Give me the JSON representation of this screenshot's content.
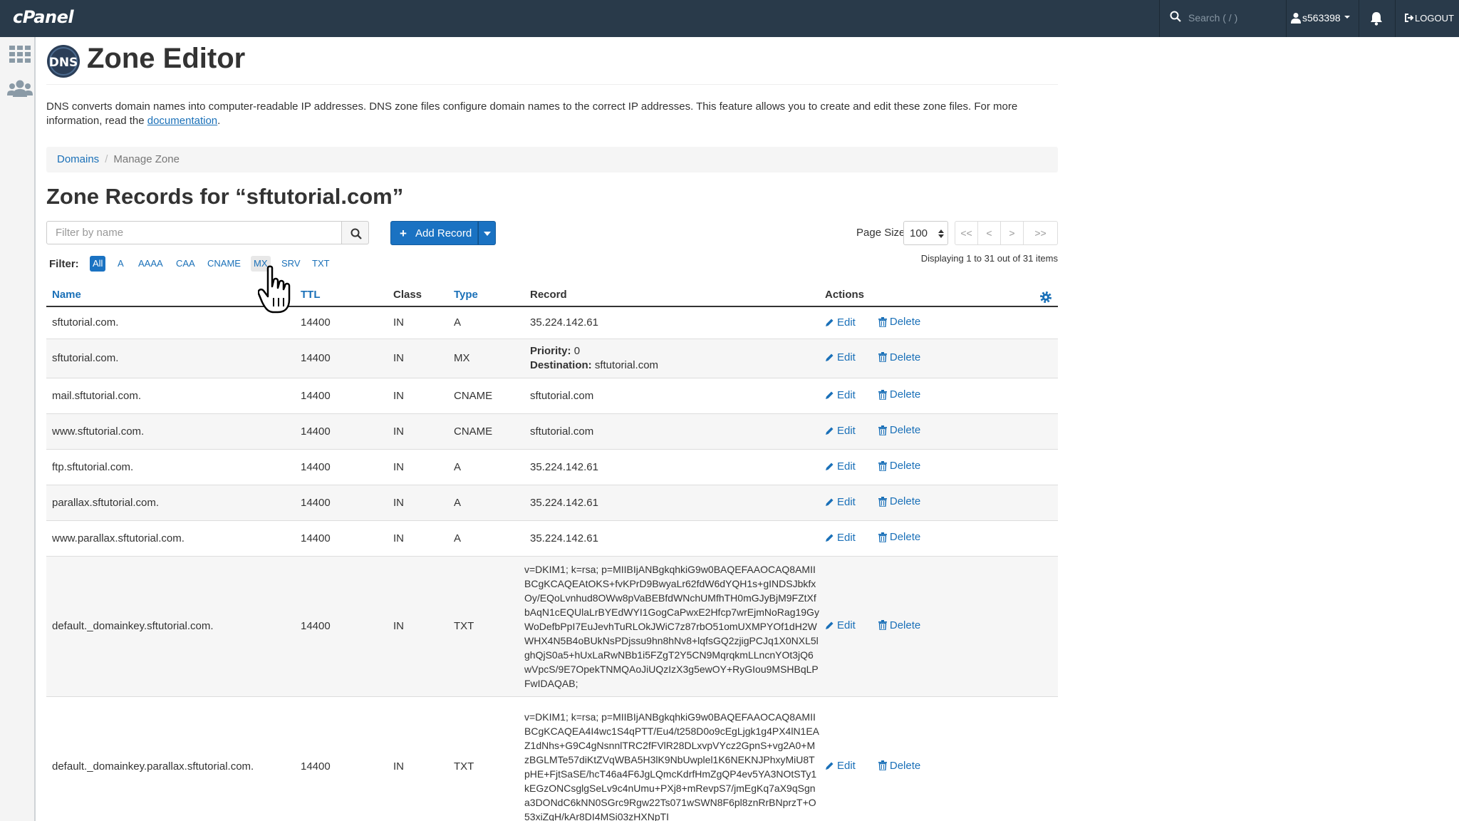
{
  "app": {
    "logo": "cPanel",
    "search_placeholder": "Search ( / )",
    "username": "s563398",
    "logout": "LOGOUT"
  },
  "page": {
    "title": "Zone Editor",
    "dns_logo_text": "DNS",
    "description_prefix": "DNS converts domain names into computer-readable IP addresses. DNS zone files configure domain names to the correct IP addresses. This feature allows you to create and edit these zone files. For more information, read the ",
    "description_link": "documentation",
    "description_suffix": "."
  },
  "breadcrumb": {
    "domains": "Domains",
    "separator": "/",
    "current": "Manage Zone"
  },
  "zone": {
    "title": "Zone Records for “sftutorial.com”",
    "filter_placeholder": "Filter by name",
    "add_record": "Add Record",
    "page_size_label": "Page Size",
    "page_size": "100",
    "displaying": "Displaying 1 to 31 out of 31 items"
  },
  "pagination": [
    "<<",
    "<",
    ">",
    ">>"
  ],
  "filters": {
    "label": "Filter:",
    "items": [
      "All",
      "A",
      "AAAA",
      "CAA",
      "CNAME",
      "MX",
      "SRV",
      "TXT"
    ],
    "active": "All",
    "hover": "MX"
  },
  "columns": {
    "name": "Name",
    "ttl": "TTL",
    "class": "Class",
    "type": "Type",
    "record": "Record",
    "actions": "Actions"
  },
  "actions": {
    "edit": "Edit",
    "delete": "Delete"
  },
  "mx_labels": {
    "priority": "Priority:",
    "destination": "Destination:"
  },
  "records": [
    {
      "name": "sftutorial.com.",
      "ttl": "14400",
      "class": "IN",
      "type": "A",
      "record": "35.224.142.61"
    },
    {
      "name": "sftutorial.com.",
      "ttl": "14400",
      "class": "IN",
      "type": "MX",
      "priority": "0",
      "destination": "sftutorial.com"
    },
    {
      "name": "mail.sftutorial.com.",
      "ttl": "14400",
      "class": "IN",
      "type": "CNAME",
      "record": "sftutorial.com"
    },
    {
      "name": "www.sftutorial.com.",
      "ttl": "14400",
      "class": "IN",
      "type": "CNAME",
      "record": "sftutorial.com"
    },
    {
      "name": "ftp.sftutorial.com.",
      "ttl": "14400",
      "class": "IN",
      "type": "A",
      "record": "35.224.142.61"
    },
    {
      "name": "parallax.sftutorial.com.",
      "ttl": "14400",
      "class": "IN",
      "type": "A",
      "record": "35.224.142.61"
    },
    {
      "name": "www.parallax.sftutorial.com.",
      "ttl": "14400",
      "class": "IN",
      "type": "A",
      "record": "35.224.142.61"
    },
    {
      "name": "default._domainkey.sftutorial.com.",
      "ttl": "14400",
      "class": "IN",
      "type": "TXT",
      "record": "v=DKIM1; k=rsa; p=MIIBIjANBgkqhkiG9w0BAQEFAAOCAQ8AMIIBCgKCAQEAtOKS+fvKPrD9BwyaLr62fdW6dYQH1s+gINDSJbkfxOy/EQoLvnhud8OWw8pVaBEBfdWNchUMfhTH0mGJyBjM9FZtXfbAqN1cEQUlaLrBYEdWYI1GogCaPwxE2Hfcp7wrEjmNoRag19GyWoDefbPpI7EuJevhTuRLOkJWiC7z87rbO51omUXMPYOf1dH2WWHX4N5B4oBUkNsPDjssu9hn8hNv8+lqfsGQ2zjigPCJq1X0NXL5lghQjS0a5+hUxLaRwNBb1i5FZgT2Y5CN9MqrqkmLLncnYOt3jQ6wVpcS/9E7OpekTNMQAoJiUQzIzX3g5ewOY+RyGIou9MSHBqLPFwIDAQAB;"
    },
    {
      "name": "default._domainkey.parallax.sftutorial.com.",
      "ttl": "14400",
      "class": "IN",
      "type": "TXT",
      "record": "v=DKIM1; k=rsa; p=MIIBIjANBgkqhkiG9w0BAQEFAAOCAQ8AMIIBCgKCAQEA4I4wc1S4qPTT/Eu4/t258D0o9cEgLjgk1g4PX4lN1EAZ1dNhs+G9C4gNsnnlTRC2fFVlR28DLxvpVYcz2GpnS+vg2A0+MzBGLMTe57diKtZVqWBA5H3lK9NbUwplel1K6NEKNJPhxyMiU8TpHE+FjtSaSE/hcT46a4F6JgLQmcKdrfHmZgQP4ev5YA3NOtSTy1kEGzONCsglgSeLv9c4nUmu+PXj8+mRevpS7/jmEgKq7aX9qSgna3DONdC6kNN0SGrc9Rgw22Ts071wSWN8F6pl8znRrBNprzT+O53xiZqH/kAr8DI4MSi03zHXNpTI"
    }
  ]
}
